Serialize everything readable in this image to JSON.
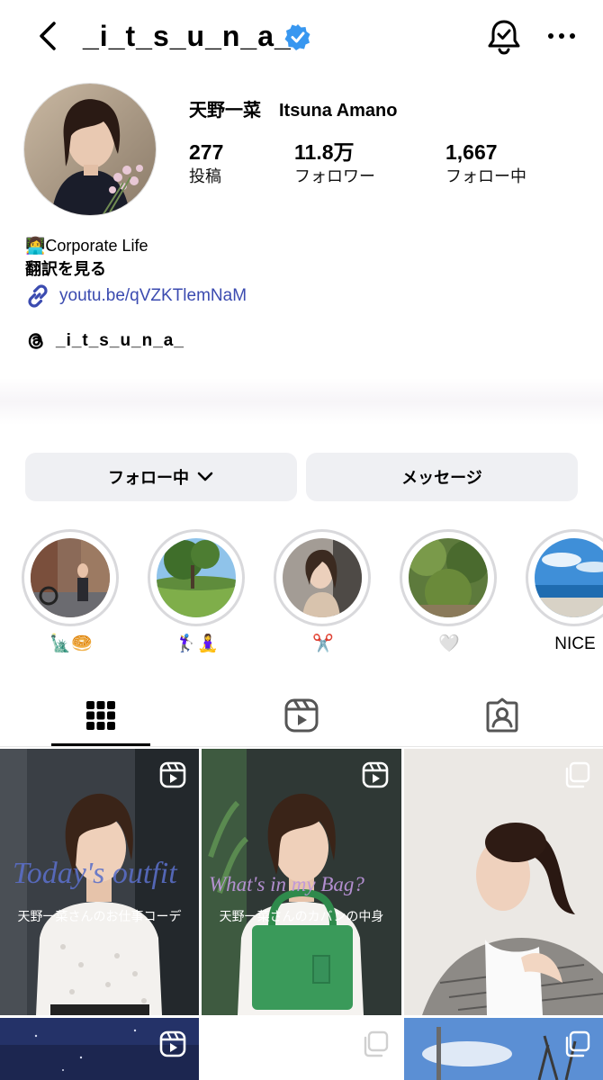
{
  "header": {
    "username": "_i_t_s_u_n_a_"
  },
  "profile": {
    "display_name": "天野一菜　Itsuna Amano",
    "stats": [
      {
        "value": "277",
        "label": "投稿"
      },
      {
        "value": "11.8万",
        "label": "フォロワー"
      },
      {
        "value": "1,667",
        "label": "フォロー中"
      }
    ],
    "bio_emoji": "👩‍💻",
    "bio_text": "Corporate Life",
    "translate_label": "翻訳を見る",
    "link": "youtu.be/qVZKTlemNaM",
    "threads_handle": "_i_t_s_u_n_a_"
  },
  "actions": {
    "following_label": "フォロー中",
    "message_label": "メッセージ"
  },
  "highlights": [
    {
      "label": "🗽🥯"
    },
    {
      "label": "🏌️‍♀️🧘‍♀️"
    },
    {
      "label": "✂️"
    },
    {
      "label": "🤍"
    },
    {
      "label": "NICE"
    }
  ],
  "posts": [
    {
      "title": "Today's outfit",
      "subtitle": "天野一菜さんのお仕事コーデ",
      "type": "reel"
    },
    {
      "title": "What's in my Bag?",
      "subtitle": "天野一菜さんのカバンの中身",
      "type": "reel"
    },
    {
      "type": "carousel"
    },
    {
      "type": "reel"
    },
    {
      "type": "carousel"
    },
    {
      "type": "carousel"
    }
  ],
  "colors": {
    "link": "#3b4bb0",
    "verified": "#3897f0",
    "button_bg": "#eff0f3"
  }
}
